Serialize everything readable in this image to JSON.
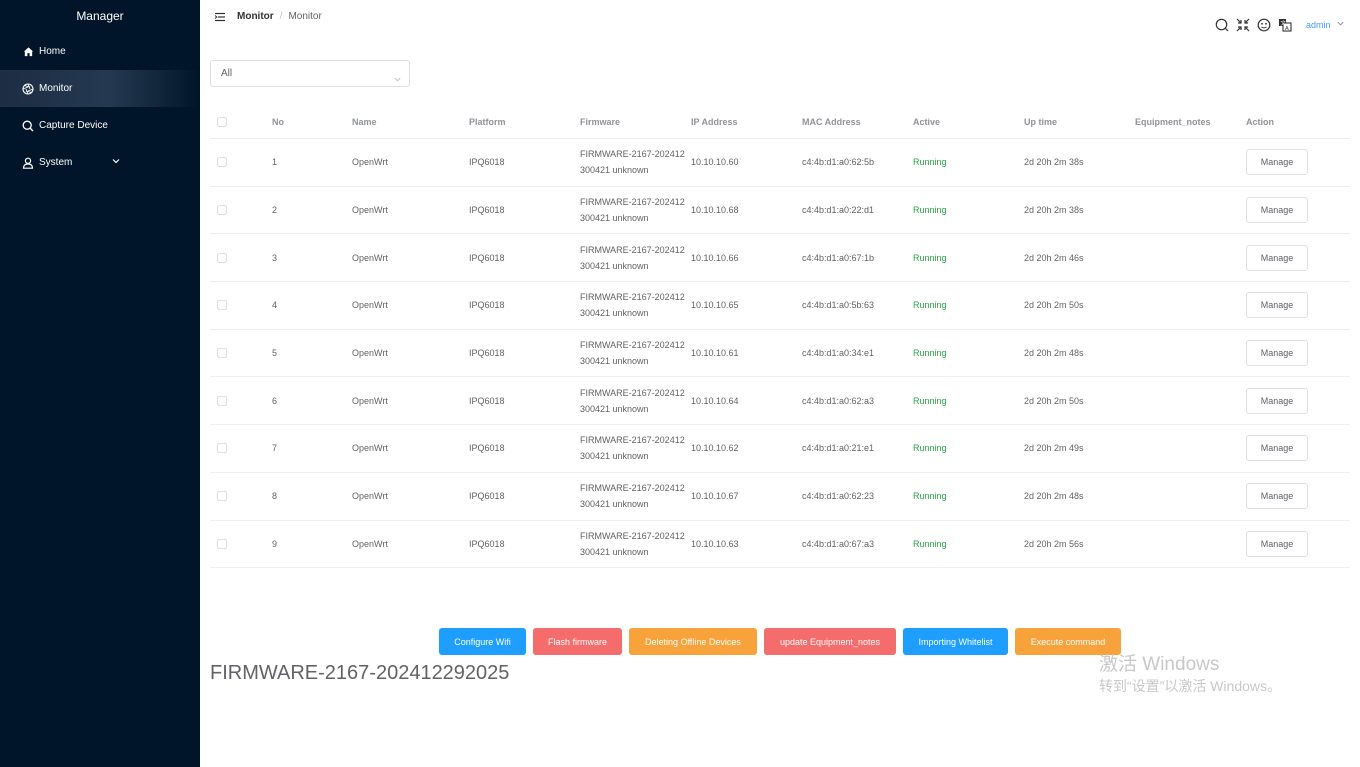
{
  "sidebar": {
    "brand": "Manager",
    "items": [
      {
        "label": "Home",
        "icon": "home-icon"
      },
      {
        "label": "Monitor",
        "icon": "aperture-icon",
        "active": true
      },
      {
        "label": "Capture Device",
        "icon": "search-icon"
      },
      {
        "label": "System",
        "icon": "user-icon",
        "has_submenu": true
      }
    ]
  },
  "header": {
    "breadcrumb": [
      "Monitor",
      "Monitor"
    ],
    "icons": [
      "search-icon",
      "fullscreen-exit-icon",
      "face-icon",
      "translate-icon"
    ],
    "user": "admin"
  },
  "filter": {
    "selected": "All"
  },
  "table": {
    "columns": [
      "No",
      "Name",
      "Platform",
      "Firmware",
      "IP Address",
      "MAC Address",
      "Active",
      "Up time",
      "Equipment_notes",
      "Action"
    ],
    "rows": [
      {
        "no": "1",
        "name": "OpenWrt",
        "platform": "IPQ6018",
        "firmware": "FIRMWARE-2167-202412300421 unknown",
        "ip": "10.10.10.60",
        "mac": "c4:4b:d1:a0:62:5b",
        "active": "Running",
        "uptime": "2d 20h 2m 38s",
        "notes": "",
        "action": "Manage"
      },
      {
        "no": "2",
        "name": "OpenWrt",
        "platform": "IPQ6018",
        "firmware": "FIRMWARE-2167-202412300421 unknown",
        "ip": "10.10.10.68",
        "mac": "c4:4b:d1:a0:22:d1",
        "active": "Running",
        "uptime": "2d 20h 2m 38s",
        "notes": "",
        "action": "Manage"
      },
      {
        "no": "3",
        "name": "OpenWrt",
        "platform": "IPQ6018",
        "firmware": "FIRMWARE-2167-202412300421 unknown",
        "ip": "10.10.10.66",
        "mac": "c4:4b:d1:a0:67:1b",
        "active": "Running",
        "uptime": "2d 20h 2m 46s",
        "notes": "",
        "action": "Manage"
      },
      {
        "no": "4",
        "name": "OpenWrt",
        "platform": "IPQ6018",
        "firmware": "FIRMWARE-2167-202412300421 unknown",
        "ip": "10.10.10.65",
        "mac": "c4:4b:d1:a0:5b:63",
        "active": "Running",
        "uptime": "2d 20h 2m 50s",
        "notes": "",
        "action": "Manage"
      },
      {
        "no": "5",
        "name": "OpenWrt",
        "platform": "IPQ6018",
        "firmware": "FIRMWARE-2167-202412300421 unknown",
        "ip": "10.10.10.61",
        "mac": "c4:4b:d1:a0:34:e1",
        "active": "Running",
        "uptime": "2d 20h 2m 48s",
        "notes": "",
        "action": "Manage"
      },
      {
        "no": "6",
        "name": "OpenWrt",
        "platform": "IPQ6018",
        "firmware": "FIRMWARE-2167-202412300421 unknown",
        "ip": "10.10.10.64",
        "mac": "c4:4b:d1:a0:62:a3",
        "active": "Running",
        "uptime": "2d 20h 2m 50s",
        "notes": "",
        "action": "Manage"
      },
      {
        "no": "7",
        "name": "OpenWrt",
        "platform": "IPQ6018",
        "firmware": "FIRMWARE-2167-202412300421 unknown",
        "ip": "10.10.10.62",
        "mac": "c4:4b:d1:a0:21:e1",
        "active": "Running",
        "uptime": "2d 20h 2m 49s",
        "notes": "",
        "action": "Manage"
      },
      {
        "no": "8",
        "name": "OpenWrt",
        "platform": "IPQ6018",
        "firmware": "FIRMWARE-2167-202412300421 unknown",
        "ip": "10.10.10.67",
        "mac": "c4:4b:d1:a0:62:23",
        "active": "Running",
        "uptime": "2d 20h 2m 48s",
        "notes": "",
        "action": "Manage"
      },
      {
        "no": "9",
        "name": "OpenWrt",
        "platform": "IPQ6018",
        "firmware": "FIRMWARE-2167-202412300421 unknown",
        "ip": "10.10.10.63",
        "mac": "c4:4b:d1:a0:67:a3",
        "active": "Running",
        "uptime": "2d 20h 2m 56s",
        "notes": "",
        "action": "Manage"
      }
    ]
  },
  "actions": [
    {
      "label": "Configure Wifi",
      "color": "#1e9fff"
    },
    {
      "label": "Flash firmware",
      "color": "#f56c6c"
    },
    {
      "label": "Deleting Offline Devices",
      "color": "#f7a23b"
    },
    {
      "label": "update Equipment_notes",
      "color": "#f56c6c"
    },
    {
      "label": "Importing Whitelist",
      "color": "#1e9fff"
    },
    {
      "label": "Execute command",
      "color": "#f7a23b"
    }
  ],
  "firmware_version": "FIRMWARE-2167-202412292025",
  "watermark": {
    "line1": "激活 Windows",
    "line2": "转到“设置”以激活 Windows。"
  },
  "colors": {
    "sidebar_bg": "#001529",
    "accent": "#409eff",
    "running": "#27a343"
  }
}
